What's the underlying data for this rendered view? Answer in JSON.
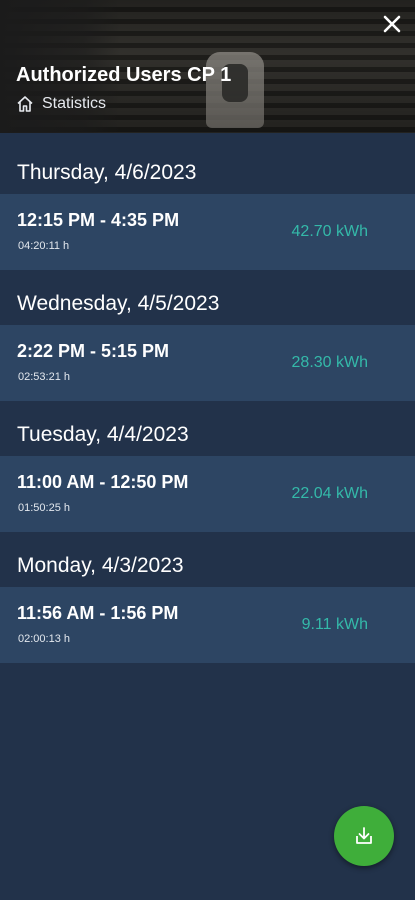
{
  "header": {
    "title": "Authorized Users CP 1",
    "breadcrumb": "Statistics",
    "close_icon": "close-icon",
    "home_icon": "home-icon"
  },
  "days": [
    {
      "date": "Thursday, 4/6/2023",
      "sessions": [
        {
          "time": "12:15 PM - 4:35 PM",
          "duration": "04:20:11 h",
          "energy": "42.70 kWh"
        }
      ]
    },
    {
      "date": "Wednesday, 4/5/2023",
      "sessions": [
        {
          "time": "2:22 PM - 5:15 PM",
          "duration": "02:53:21 h",
          "energy": "28.30 kWh"
        }
      ]
    },
    {
      "date": "Tuesday, 4/4/2023",
      "sessions": [
        {
          "time": "11:00 AM - 12:50 PM",
          "duration": "01:50:25 h",
          "energy": "22.04 kWh"
        }
      ]
    },
    {
      "date": "Monday, 4/3/2023",
      "sessions": [
        {
          "time": "11:56 AM - 1:56 PM",
          "duration": "02:00:13 h",
          "energy": "9.11 kWh"
        }
      ]
    }
  ],
  "fab": {
    "icon": "download-icon"
  },
  "colors": {
    "background": "#22324a",
    "row": "#2d4563",
    "energy": "#34b9a9",
    "fab": "#3fae3a"
  }
}
